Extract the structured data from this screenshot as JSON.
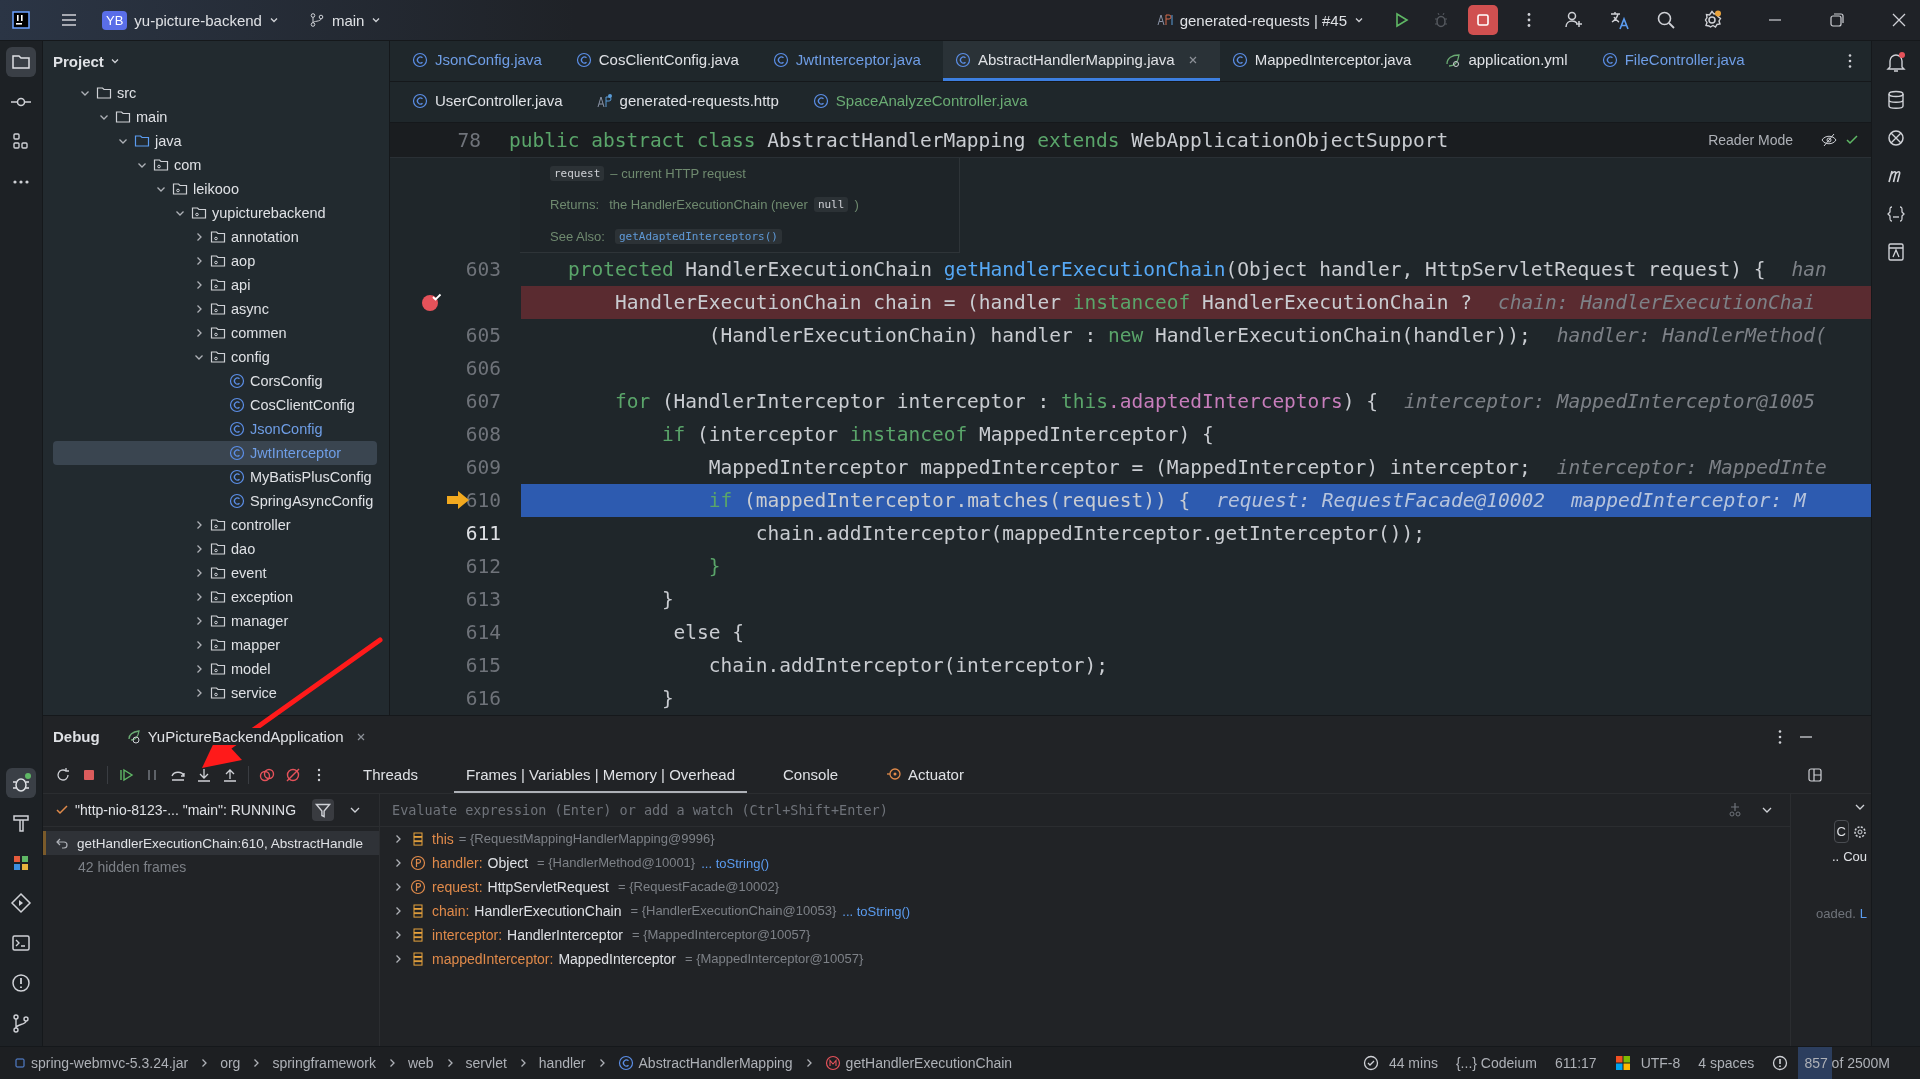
{
  "top_bar": {
    "project_badge": "YB",
    "project": "yu-picture-backend",
    "branch": "main",
    "run_config": "generated-requests | #45"
  },
  "project_panel": {
    "title": "Project",
    "tree": [
      {
        "label": "src",
        "kind": "folder",
        "expanded": true,
        "children": [
          {
            "label": "main",
            "kind": "folder",
            "expanded": true,
            "children": [
              {
                "label": "java",
                "kind": "source",
                "expanded": true,
                "children": [
                  {
                    "label": "com",
                    "kind": "package",
                    "expanded": true,
                    "children": [
                      {
                        "label": "leikooo",
                        "kind": "package",
                        "expanded": true,
                        "children": [
                          {
                            "label": "yupicturebackend",
                            "kind": "package",
                            "expanded": true,
                            "children": [
                              {
                                "label": "annotation",
                                "kind": "package",
                                "expanded": false
                              },
                              {
                                "label": "aop",
                                "kind": "package",
                                "expanded": false
                              },
                              {
                                "label": "api",
                                "kind": "package",
                                "expanded": false
                              },
                              {
                                "label": "async",
                                "kind": "package",
                                "expanded": false
                              },
                              {
                                "label": "commen",
                                "kind": "package",
                                "expanded": false
                              },
                              {
                                "label": "config",
                                "kind": "package",
                                "expanded": true,
                                "children": [
                                  {
                                    "label": "CorsConfig",
                                    "kind": "class",
                                    "selected": false,
                                    "color": "#dfe1e5"
                                  },
                                  {
                                    "label": "CosClientConfig",
                                    "kind": "class",
                                    "selected": false,
                                    "color": "#dfe1e5"
                                  },
                                  {
                                    "label": "JsonConfig",
                                    "kind": "class",
                                    "selected": false,
                                    "color": "#6f9ee6"
                                  },
                                  {
                                    "label": "JwtInterceptor",
                                    "kind": "class",
                                    "selected": true,
                                    "color": "#6f9ee6"
                                  },
                                  {
                                    "label": "MyBatisPlusConfig",
                                    "kind": "class",
                                    "selected": false,
                                    "color": "#dfe1e5"
                                  },
                                  {
                                    "label": "SpringAsyncConfig",
                                    "kind": "class",
                                    "selected": false,
                                    "color": "#dfe1e5"
                                  }
                                ]
                              },
                              {
                                "label": "controller",
                                "kind": "package",
                                "expanded": false
                              },
                              {
                                "label": "dao",
                                "kind": "package",
                                "expanded": false
                              },
                              {
                                "label": "event",
                                "kind": "package",
                                "expanded": false
                              },
                              {
                                "label": "exception",
                                "kind": "package",
                                "expanded": false
                              },
                              {
                                "label": "manager",
                                "kind": "package",
                                "expanded": false
                              },
                              {
                                "label": "mapper",
                                "kind": "package",
                                "expanded": false
                              },
                              {
                                "label": "model",
                                "kind": "package",
                                "expanded": false
                              },
                              {
                                "label": "service",
                                "kind": "package",
                                "expanded": false
                              }
                            ]
                          }
                        ]
                      }
                    ]
                  }
                ]
              }
            ]
          }
        ]
      }
    ]
  },
  "tab_rows": [
    {
      "tabs": [
        {
          "label": "JsonConfig.java",
          "kind": "class",
          "selected": false,
          "color": "#6f9ee6"
        },
        {
          "label": "CosClientConfig.java",
          "kind": "class",
          "selected": false,
          "color": "#dfe1e5"
        },
        {
          "label": "JwtInterceptor.java",
          "kind": "class",
          "selected": false,
          "color": "#6f9ee6"
        },
        {
          "label": "AbstractHandlerMapping.java",
          "kind": "class",
          "selected": true,
          "color": "#dfe1e5"
        },
        {
          "label": "MappedInterceptor.java",
          "kind": "class",
          "selected": false,
          "color": "#dfe1e5"
        },
        {
          "label": "application.yml",
          "kind": "yml",
          "selected": false,
          "color": "#dfe1e5"
        },
        {
          "label": "FileController.java",
          "kind": "class",
          "selected": false,
          "color": "#6f9ee6"
        }
      ]
    },
    {
      "tabs": [
        {
          "label": "UserController.java",
          "kind": "class",
          "selected": false,
          "color": "#dfe1e5"
        },
        {
          "label": "generated-requests.http",
          "kind": "api",
          "selected": false,
          "color": "#dfe1e5"
        },
        {
          "label": "SpaceAnalyzeController.java",
          "kind": "class",
          "selected": false,
          "color": "#6aab73"
        }
      ]
    }
  ],
  "sticky_line": {
    "number": "78",
    "reader_mode": "Reader Mode",
    "tokens": [
      {
        "t": "public abstract class",
        "kind": "kw"
      },
      {
        "t": " AbstractHandlerMapping ",
        "kind": "plain"
      },
      {
        "t": "extends",
        "kind": "kw"
      },
      {
        "t": " WebApplicationObjectSupport",
        "kind": "plain"
      }
    ]
  },
  "doc": {
    "param_name": "request",
    "param_text": "– current HTTP request",
    "returns_label": "Returns:",
    "returns_text": "the HandlerExecutionChain (never",
    "returns_code": "null",
    "returns_end": ")",
    "see_also_label": "See Also:",
    "see_also_link": "getAdaptedInterceptors()"
  },
  "code_lines": [
    {
      "number": "603",
      "kind": "normal",
      "tokens": [
        {
          "t": "    protected",
          "kind": "kw"
        },
        {
          "t": " HandlerExecutionChain ",
          "kind": "plain"
        },
        {
          "t": "getHandlerExecutionChain",
          "kind": "fn"
        },
        {
          "t": "(Object handler, HttpServletRequest request) {",
          "kind": "plain"
        },
        {
          "t": "han",
          "kind": "hint"
        }
      ]
    },
    {
      "kind": "breakpoint",
      "tokens": [
        {
          "t": "        HandlerExecutionChain chain = (handler ",
          "kind": "plain"
        },
        {
          "t": "instanceof",
          "kind": "kw"
        },
        {
          "t": " HandlerExecutionChain ?",
          "kind": "plain"
        },
        {
          "t": "chain: HandlerExecutionChai",
          "kind": "hint"
        }
      ]
    },
    {
      "number": "605",
      "kind": "normal",
      "tokens": [
        {
          "t": "                (HandlerExecutionChain) handler : ",
          "kind": "plain"
        },
        {
          "t": "new",
          "kind": "kw"
        },
        {
          "t": " HandlerExecutionChain(handler));",
          "kind": "plain"
        },
        {
          "t": "handler: HandlerMethod(",
          "kind": "hint"
        }
      ]
    },
    {
      "number": "606",
      "kind": "normal"
    },
    {
      "number": "607",
      "kind": "normal",
      "tokens": [
        {
          "t": "        for",
          "kind": "kw"
        },
        {
          "t": " (HandlerInterceptor interceptor : ",
          "kind": "plain"
        },
        {
          "t": "this",
          "kind": "kw"
        },
        {
          "t": ".adaptedInterceptors",
          "kind": "field"
        },
        {
          "t": ") {",
          "kind": "plain"
        },
        {
          "t": "interceptor: MappedInterceptor@1005",
          "kind": "hint"
        }
      ]
    },
    {
      "number": "608",
      "kind": "normal",
      "tokens": [
        {
          "t": "            if",
          "kind": "kw"
        },
        {
          "t": " (interceptor ",
          "kind": "plain"
        },
        {
          "t": "instanceof",
          "kind": "kw"
        },
        {
          "t": " MappedInterceptor) {",
          "kind": "plain"
        }
      ]
    },
    {
      "number": "609",
      "kind": "normal",
      "tokens": [
        {
          "t": "                MappedInterceptor mappedInterceptor = (MappedInterceptor) interceptor;",
          "kind": "plain"
        },
        {
          "t": "interceptor: MappedInte",
          "kind": "hint"
        }
      ]
    },
    {
      "number": "610",
      "kind": "execution",
      "tokens": [
        {
          "t": "                if",
          "kind": "kw"
        },
        {
          "t": " (mappedInterceptor.matches(request)) {",
          "kind": "plain"
        },
        {
          "t": "request: RequestFacade@10002",
          "kind": "hint"
        },
        {
          "t": "mappedInterceptor: M",
          "kind": "hint"
        }
      ]
    },
    {
      "number": "611",
      "kind": "current",
      "tokens": [
        {
          "t": "                    chain.addInterceptor(mappedInterceptor.getInterceptor());",
          "kind": "plain"
        }
      ]
    },
    {
      "number": "612",
      "kind": "normal",
      "tokens": [
        {
          "t": "                }",
          "kind": "kw"
        }
      ]
    },
    {
      "number": "613",
      "kind": "normal",
      "tokens": [
        {
          "t": "            }",
          "kind": "plain"
        }
      ]
    },
    {
      "number": "614",
      "kind": "normal",
      "tokens": [
        {
          "t": "             else {",
          "kind": "plain"
        }
      ]
    },
    {
      "number": "615",
      "kind": "normal",
      "tokens": [
        {
          "t": "                chain.addInterceptor(interceptor);",
          "kind": "plain"
        }
      ]
    },
    {
      "number": "616",
      "kind": "normal",
      "tokens": [
        {
          "t": "            }",
          "kind": "plain"
        }
      ]
    }
  ],
  "debug": {
    "title": "Debug",
    "session_tab": "YuPictureBackendApplication",
    "tabs": [
      {
        "label": "Threads",
        "kind": "plain",
        "selected": false
      },
      {
        "label": "Frames | Variables | Memory | Overhead",
        "kind": "plain",
        "selected": true
      },
      {
        "label": "Console",
        "kind": "plain",
        "selected": false
      },
      {
        "label": "Actuator",
        "kind": "actuator",
        "selected": false
      }
    ],
    "thread": "\"http-nio-8123-... \"main\": RUNNING",
    "frames": [
      {
        "label": "getHandlerExecutionChain:610, AbstractHandle",
        "selected": true
      }
    ],
    "hidden_frames": "42 hidden frames",
    "evaluate_placeholder": "Evaluate expression (Enter) or add a watch (Ctrl+Shift+Enter)",
    "variables": [
      {
        "kind": "field",
        "name": "this",
        "value": "= {RequestMappingHandlerMapping@9996}"
      },
      {
        "kind": "param",
        "name": "handler:",
        "type": "Object",
        "value": "= {HandlerMethod@10001}",
        "link": "... toString()"
      },
      {
        "kind": "param",
        "name": "request:",
        "type": "HttpServletRequest",
        "value": "= {RequestFacade@10002}"
      },
      {
        "kind": "field",
        "name": "chain:",
        "type": "HandlerExecutionChain",
        "value": "= {HandlerExecutionChain@10053}",
        "link": "... toString()"
      },
      {
        "kind": "field",
        "name": "interceptor:",
        "type": "HandlerInterceptor",
        "value": "= {MappedInterceptor@10057}"
      },
      {
        "kind": "field",
        "name": "mappedInterceptor:",
        "type": "MappedInterceptor",
        "value": "= {MappedInterceptor@10057}"
      }
    ],
    "side_panel": {
      "tile": "C",
      "label": "Cou",
      "dots": "..",
      "message": "oaded.",
      "message_link": "L"
    }
  },
  "status_bar": {
    "breadcrumbs": [
      {
        "label": "spring-webmvc-5.3.24.jar",
        "kind": "jar"
      },
      {
        "label": "org",
        "kind": "plain"
      },
      {
        "label": "springframework",
        "kind": "plain"
      },
      {
        "label": "web",
        "kind": "plain"
      },
      {
        "label": "servlet",
        "kind": "plain"
      },
      {
        "label": "handler",
        "kind": "plain"
      },
      {
        "label": "AbstractHandlerMapping",
        "kind": "class"
      },
      {
        "label": "getHandlerExecutionChain",
        "kind": "method"
      }
    ],
    "time": "44 mins",
    "codeium": "{...} Codeium",
    "position": "611:17",
    "encoding": "UTF-8",
    "indent": "4 spaces",
    "memory": {
      "text": "857 of 2500M",
      "level": 0.34
    }
  }
}
